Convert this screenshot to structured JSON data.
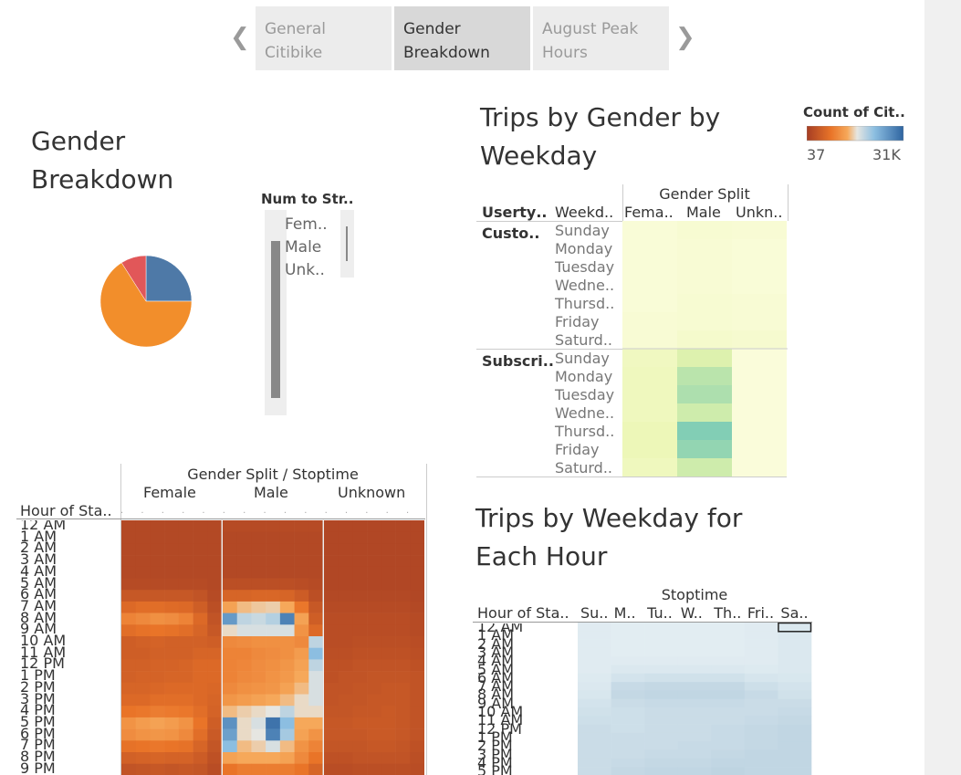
{
  "nav": {
    "tabs": [
      {
        "line1": "General",
        "line2": "Citibike"
      },
      {
        "line1": "Gender",
        "line2": "Breakdown"
      },
      {
        "line1": "August Peak",
        "line2": "Hours"
      }
    ],
    "active_tab": 1,
    "prev_icon": "chevron-left-icon",
    "next_icon": "chevron-right-icon"
  },
  "gender_breakdown": {
    "title_line1": "Gender",
    "title_line2": "Breakdown",
    "colors": [
      "#4e79a7",
      "#f28e2b",
      "#e15759"
    ]
  },
  "pie_data": {
    "type": "pie",
    "slices": [
      {
        "value": 25,
        "color": "#4e79a7"
      },
      {
        "value": 66,
        "color": "#f28e2b"
      },
      {
        "value": 9,
        "color": "#e15759"
      }
    ]
  },
  "legend": {
    "title": "Num to Str..",
    "items": [
      "Fem..",
      "Male",
      "Unk.."
    ]
  },
  "color_legend": {
    "title": "Count of Cit..",
    "min_label": "37",
    "max_label": "31K"
  },
  "weekday_chart": {
    "title_line1": "Trips by Gender by",
    "title_line2": "Weekday",
    "group_header": "Gender Split",
    "col_headers": [
      "Usertу..",
      "Weekd.."
    ],
    "gender_cols": [
      "Fema..",
      "Male",
      "Unkn.."
    ],
    "groups": [
      "Custo..",
      "Subscri.."
    ],
    "days": [
      "Sunday",
      "Monday",
      "Tuesday",
      "Wedne..",
      "Thursd..",
      "Friday",
      "Saturd.."
    ]
  },
  "weekday_data": {
    "type": "heatmap",
    "scale": [
      37,
      31000
    ],
    "customer": [
      [
        0.01,
        0.03,
        0.02
      ],
      [
        0.01,
        0.02,
        0.01
      ],
      [
        0.01,
        0.02,
        0.01
      ],
      [
        0.01,
        0.02,
        0.01
      ],
      [
        0.01,
        0.03,
        0.02
      ],
      [
        0.02,
        0.03,
        0.02
      ],
      [
        0.02,
        0.05,
        0.04
      ]
    ],
    "subscriber": [
      [
        0.09,
        0.22,
        0.0
      ],
      [
        0.1,
        0.38,
        0.0
      ],
      [
        0.1,
        0.42,
        0.0
      ],
      [
        0.1,
        0.3,
        0.0
      ],
      [
        0.12,
        0.55,
        0.0
      ],
      [
        0.12,
        0.5,
        0.0
      ],
      [
        0.1,
        0.3,
        0.0
      ]
    ]
  },
  "hour_chart": {
    "header_line1": "Gender Split  /  Stoptime",
    "gender_cols": [
      "Female",
      "Male",
      "Unknown"
    ],
    "row_header": "Hour of Sta..",
    "hours": [
      "12 AM",
      "1 AM",
      "2 AM",
      "3 AM",
      "4 AM",
      "5 AM",
      "6 AM",
      "7 AM",
      "8 AM",
      "9 AM",
      "10 AM",
      "11 AM",
      "12 PM",
      "1 PM",
      "2 PM",
      "3 PM",
      "4 PM",
      "5 PM",
      "6 PM",
      "7 PM",
      "8 PM",
      "9 PM"
    ]
  },
  "hour_data": {
    "type": "heatmap",
    "columns": 7,
    "female": [
      [
        0.05,
        0.05,
        0.05,
        0.05,
        0.05,
        0.05,
        0.05
      ],
      [
        0.05,
        0.05,
        0.05,
        0.05,
        0.05,
        0.05,
        0.05
      ],
      [
        0.05,
        0.05,
        0.05,
        0.05,
        0.05,
        0.05,
        0.05
      ],
      [
        0.05,
        0.05,
        0.05,
        0.05,
        0.05,
        0.05,
        0.05
      ],
      [
        0.05,
        0.05,
        0.05,
        0.05,
        0.05,
        0.05,
        0.05
      ],
      [
        0.06,
        0.06,
        0.06,
        0.06,
        0.06,
        0.06,
        0.05
      ],
      [
        0.12,
        0.12,
        0.12,
        0.12,
        0.12,
        0.1,
        0.06
      ],
      [
        0.2,
        0.22,
        0.22,
        0.21,
        0.2,
        0.15,
        0.08
      ],
      [
        0.3,
        0.32,
        0.34,
        0.33,
        0.3,
        0.2,
        0.1
      ],
      [
        0.22,
        0.24,
        0.25,
        0.24,
        0.22,
        0.18,
        0.12
      ],
      [
        0.15,
        0.16,
        0.17,
        0.16,
        0.16,
        0.16,
        0.15
      ],
      [
        0.15,
        0.15,
        0.16,
        0.16,
        0.16,
        0.18,
        0.18
      ],
      [
        0.16,
        0.16,
        0.17,
        0.17,
        0.18,
        0.2,
        0.2
      ],
      [
        0.16,
        0.17,
        0.17,
        0.18,
        0.18,
        0.2,
        0.2
      ],
      [
        0.18,
        0.18,
        0.19,
        0.2,
        0.2,
        0.2,
        0.19
      ],
      [
        0.2,
        0.2,
        0.22,
        0.22,
        0.22,
        0.2,
        0.18
      ],
      [
        0.25,
        0.26,
        0.28,
        0.27,
        0.26,
        0.22,
        0.17
      ],
      [
        0.35,
        0.38,
        0.4,
        0.38,
        0.35,
        0.25,
        0.15
      ],
      [
        0.33,
        0.35,
        0.36,
        0.35,
        0.32,
        0.22,
        0.13
      ],
      [
        0.24,
        0.25,
        0.26,
        0.25,
        0.24,
        0.18,
        0.11
      ],
      [
        0.16,
        0.17,
        0.18,
        0.17,
        0.17,
        0.14,
        0.09
      ],
      [
        0.1,
        0.11,
        0.12,
        0.11,
        0.12,
        0.11,
        0.07
      ]
    ],
    "male": [
      [
        0.06,
        0.06,
        0.06,
        0.06,
        0.06,
        0.06,
        0.06
      ],
      [
        0.05,
        0.05,
        0.05,
        0.05,
        0.05,
        0.05,
        0.05
      ],
      [
        0.05,
        0.05,
        0.05,
        0.05,
        0.05,
        0.05,
        0.05
      ],
      [
        0.05,
        0.05,
        0.05,
        0.05,
        0.05,
        0.05,
        0.05
      ],
      [
        0.05,
        0.05,
        0.05,
        0.05,
        0.05,
        0.05,
        0.05
      ],
      [
        0.08,
        0.08,
        0.08,
        0.08,
        0.08,
        0.07,
        0.06
      ],
      [
        0.18,
        0.18,
        0.19,
        0.19,
        0.18,
        0.14,
        0.08
      ],
      [
        0.4,
        0.45,
        0.47,
        0.48,
        0.42,
        0.26,
        0.12
      ],
      [
        0.82,
        0.6,
        0.58,
        0.62,
        0.9,
        0.4,
        0.15
      ],
      [
        0.5,
        0.55,
        0.55,
        0.55,
        0.55,
        0.35,
        0.2
      ],
      [
        0.32,
        0.33,
        0.34,
        0.34,
        0.34,
        0.32,
        0.6
      ],
      [
        0.3,
        0.3,
        0.32,
        0.33,
        0.34,
        0.38,
        0.7
      ],
      [
        0.3,
        0.31,
        0.33,
        0.34,
        0.36,
        0.4,
        0.6
      ],
      [
        0.3,
        0.32,
        0.33,
        0.35,
        0.37,
        0.42,
        0.55
      ],
      [
        0.32,
        0.34,
        0.35,
        0.36,
        0.4,
        0.45,
        0.55
      ],
      [
        0.36,
        0.38,
        0.4,
        0.42,
        0.45,
        0.5,
        0.55
      ],
      [
        0.45,
        0.48,
        0.5,
        0.52,
        0.6,
        0.5,
        0.5
      ],
      [
        0.85,
        0.5,
        0.55,
        0.95,
        0.7,
        0.42,
        0.42
      ],
      [
        0.8,
        0.5,
        0.52,
        0.9,
        0.65,
        0.4,
        0.35
      ],
      [
        0.7,
        0.45,
        0.48,
        0.55,
        0.45,
        0.35,
        0.3
      ],
      [
        0.4,
        0.42,
        0.42,
        0.42,
        0.4,
        0.32,
        0.25
      ],
      [
        0.25,
        0.28,
        0.28,
        0.28,
        0.28,
        0.25,
        0.18
      ]
    ],
    "unknown": [
      [
        0.04,
        0.04,
        0.04,
        0.04,
        0.04,
        0.04,
        0.04
      ],
      [
        0.04,
        0.04,
        0.04,
        0.04,
        0.04,
        0.04,
        0.04
      ],
      [
        0.04,
        0.04,
        0.04,
        0.04,
        0.04,
        0.04,
        0.04
      ],
      [
        0.04,
        0.04,
        0.04,
        0.04,
        0.04,
        0.04,
        0.04
      ],
      [
        0.04,
        0.04,
        0.04,
        0.04,
        0.04,
        0.04,
        0.04
      ],
      [
        0.04,
        0.04,
        0.04,
        0.04,
        0.04,
        0.04,
        0.04
      ],
      [
        0.05,
        0.05,
        0.05,
        0.05,
        0.05,
        0.05,
        0.04
      ],
      [
        0.06,
        0.06,
        0.06,
        0.06,
        0.06,
        0.06,
        0.05
      ],
      [
        0.07,
        0.07,
        0.07,
        0.07,
        0.07,
        0.07,
        0.06
      ],
      [
        0.07,
        0.07,
        0.07,
        0.07,
        0.07,
        0.07,
        0.06
      ],
      [
        0.07,
        0.07,
        0.08,
        0.08,
        0.08,
        0.08,
        0.07
      ],
      [
        0.08,
        0.08,
        0.09,
        0.09,
        0.09,
        0.09,
        0.08
      ],
      [
        0.09,
        0.09,
        0.1,
        0.1,
        0.1,
        0.1,
        0.09
      ],
      [
        0.09,
        0.1,
        0.1,
        0.11,
        0.11,
        0.11,
        0.1
      ],
      [
        0.1,
        0.1,
        0.11,
        0.11,
        0.12,
        0.12,
        0.1
      ],
      [
        0.1,
        0.11,
        0.11,
        0.12,
        0.12,
        0.12,
        0.1
      ],
      [
        0.11,
        0.11,
        0.12,
        0.12,
        0.13,
        0.12,
        0.1
      ],
      [
        0.12,
        0.12,
        0.13,
        0.13,
        0.13,
        0.12,
        0.1
      ],
      [
        0.12,
        0.12,
        0.12,
        0.13,
        0.13,
        0.12,
        0.1
      ],
      [
        0.11,
        0.11,
        0.11,
        0.12,
        0.12,
        0.11,
        0.09
      ],
      [
        0.09,
        0.09,
        0.1,
        0.1,
        0.1,
        0.1,
        0.08
      ],
      [
        0.07,
        0.07,
        0.08,
        0.08,
        0.08,
        0.08,
        0.07
      ]
    ]
  },
  "weekday_hour_chart": {
    "title_line1": "Trips by Weekday for",
    "title_line2": "Each Hour",
    "header": "Stoptime",
    "row_header": "Hour of Sta..",
    "day_cols": [
      "Su..",
      "M..",
      "Tu..",
      "W..",
      "Th..",
      "Fri..",
      "Sa.."
    ],
    "hours": [
      "12 AM",
      "1 AM",
      "2 AM",
      "3 AM",
      "4 AM",
      "5 AM",
      "6 AM",
      "7 AM",
      "8 AM",
      "9 AM",
      "10 AM",
      "11 AM",
      "12 PM",
      "1 PM",
      "2 PM",
      "3 PM",
      "4 PM",
      "5 PM"
    ]
  },
  "weekday_hour_data": {
    "type": "heatmap",
    "values": [
      [
        0.05,
        0.04,
        0.04,
        0.04,
        0.04,
        0.05,
        0.07
      ],
      [
        0.05,
        0.04,
        0.04,
        0.04,
        0.04,
        0.05,
        0.07
      ],
      [
        0.05,
        0.04,
        0.04,
        0.04,
        0.04,
        0.05,
        0.07
      ],
      [
        0.05,
        0.04,
        0.04,
        0.04,
        0.04,
        0.05,
        0.07
      ],
      [
        0.05,
        0.05,
        0.05,
        0.05,
        0.05,
        0.05,
        0.07
      ],
      [
        0.05,
        0.07,
        0.07,
        0.07,
        0.07,
        0.06,
        0.07
      ],
      [
        0.06,
        0.1,
        0.11,
        0.11,
        0.11,
        0.09,
        0.08
      ],
      [
        0.07,
        0.14,
        0.15,
        0.15,
        0.15,
        0.12,
        0.1
      ],
      [
        0.08,
        0.15,
        0.16,
        0.16,
        0.16,
        0.14,
        0.11
      ],
      [
        0.1,
        0.13,
        0.14,
        0.14,
        0.14,
        0.13,
        0.13
      ],
      [
        0.11,
        0.12,
        0.13,
        0.13,
        0.13,
        0.13,
        0.14
      ],
      [
        0.12,
        0.12,
        0.13,
        0.13,
        0.13,
        0.14,
        0.15
      ],
      [
        0.13,
        0.12,
        0.13,
        0.13,
        0.14,
        0.15,
        0.16
      ],
      [
        0.13,
        0.13,
        0.13,
        0.13,
        0.14,
        0.15,
        0.16
      ],
      [
        0.13,
        0.13,
        0.13,
        0.14,
        0.14,
        0.15,
        0.16
      ],
      [
        0.13,
        0.13,
        0.14,
        0.14,
        0.15,
        0.16,
        0.16
      ],
      [
        0.13,
        0.14,
        0.15,
        0.15,
        0.16,
        0.16,
        0.16
      ],
      [
        0.13,
        0.15,
        0.16,
        0.16,
        0.17,
        0.16,
        0.16
      ]
    ]
  }
}
